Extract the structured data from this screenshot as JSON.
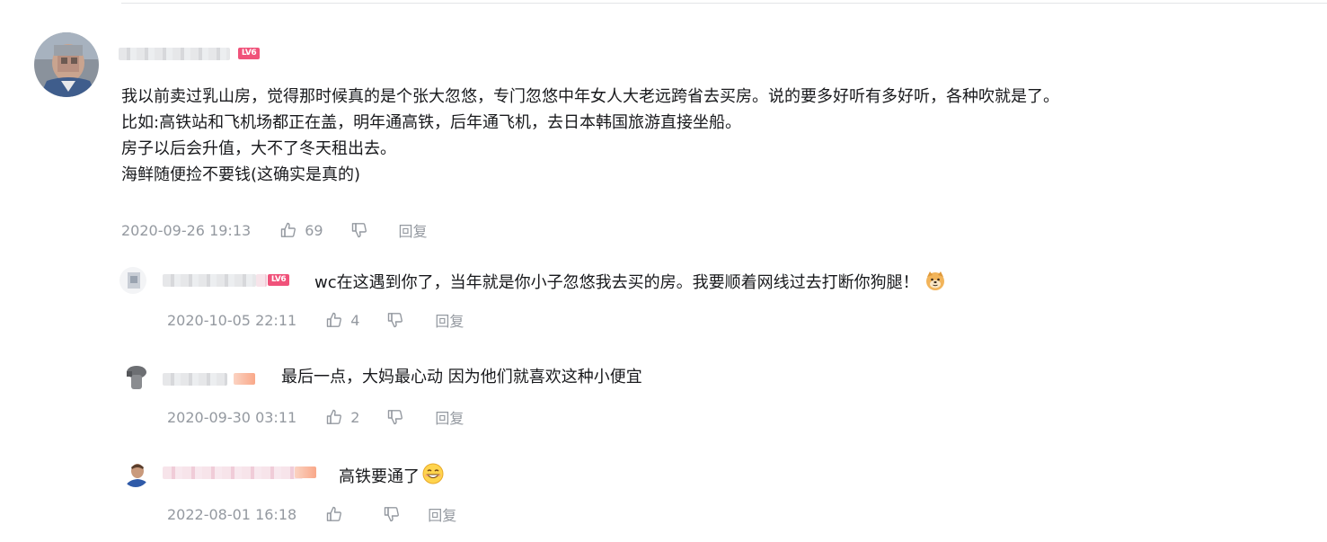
{
  "main_comment": {
    "lines": [
      "我以前卖过乳山房，觉得那时候真的是个张大忽悠，专门忽悠中年女人大老远跨省去买房。说的要多好听有多好听，各种吹就是了。",
      "比如:高铁站和飞机场都正在盖，明年通高铁，后年通飞机，去日本韩国旅游直接坐船。",
      "房子以后会升值，大不了冬天租出去。",
      "海鲜随便捡不要钱(这确实是真的)"
    ],
    "time": "2020-09-26 19:13",
    "likes": "69",
    "reply_label": "回复"
  },
  "replies": [
    {
      "text": "wc在这遇到你了，当年就是你小子忽悠我去买的房。我要顺着网线过去打断你狗腿！",
      "emoji": "doge-emoji",
      "time": "2020-10-05 22:11",
      "likes": "4",
      "reply_label": "回复"
    },
    {
      "text": "最后一点，大妈最心动 因为他们就喜欢这种小便宜",
      "time": "2020-09-30 03:11",
      "likes": "2",
      "reply_label": "回复"
    },
    {
      "text": "高铁要通了",
      "emoji": "grinning-emoji",
      "time": "2022-08-01 16:18",
      "likes": "",
      "reply_label": "回复"
    }
  ],
  "colors": {
    "text": "#18191c",
    "meta": "#9499a0",
    "level_badge": "#f0527a",
    "divider": "#e3e5e7"
  }
}
